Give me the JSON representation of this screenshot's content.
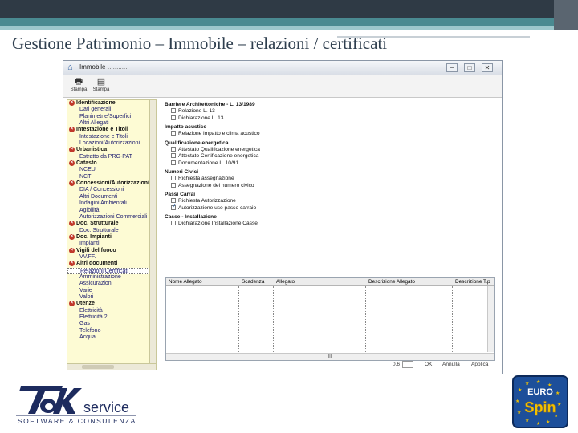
{
  "slide": {
    "title": "Gestione Patrimonio – Immobile – relazioni / certificati"
  },
  "window": {
    "title": "Immobile",
    "subtitle": "...........",
    "buttons": {
      "minimize": "─",
      "maximize": "□",
      "close": "✕"
    }
  },
  "toolbar": {
    "items": [
      {
        "label": "Stampa",
        "icon": "printer-icon"
      },
      {
        "label": "Stampa",
        "icon": "print-preview-icon"
      }
    ]
  },
  "tree": {
    "rows": [
      {
        "label": "Identificazione",
        "type": "section"
      },
      {
        "label": "Dati generali",
        "type": "sub"
      },
      {
        "label": "Planimetrie/Superfici",
        "type": "sub"
      },
      {
        "label": "Altri Allegati",
        "type": "sub"
      },
      {
        "label": "Intestazione e Titoli",
        "type": "section"
      },
      {
        "label": "Intestazione e Titoli",
        "type": "sub"
      },
      {
        "label": "Locazioni/Autorizzazioni",
        "type": "sub"
      },
      {
        "label": "Urbanistica",
        "type": "section"
      },
      {
        "label": "Estratto da PRG-PAT",
        "type": "sub"
      },
      {
        "label": "Catasto",
        "type": "section"
      },
      {
        "label": "NCEU",
        "type": "sub"
      },
      {
        "label": "NCT",
        "type": "sub"
      },
      {
        "label": "Concessioni/Autorizzazioni",
        "type": "section"
      },
      {
        "label": "DIA / Concessioni",
        "type": "sub"
      },
      {
        "label": "Altri Documenti",
        "type": "sub"
      },
      {
        "label": "Indagini Ambientali",
        "type": "sub"
      },
      {
        "label": "Agibilità",
        "type": "sub"
      },
      {
        "label": "Autorizzazioni Commerciali",
        "type": "sub"
      },
      {
        "label": "Doc. Strutturale",
        "type": "section"
      },
      {
        "label": "Doc. Strutturale",
        "type": "sub"
      },
      {
        "label": "Doc. Impianti",
        "type": "section"
      },
      {
        "label": "Impianti",
        "type": "sub"
      },
      {
        "label": "Vigili del fuoco",
        "type": "section"
      },
      {
        "label": "VV.FF.",
        "type": "sub"
      },
      {
        "label": "Altri documenti",
        "type": "section"
      },
      {
        "label": "Relazioni/Certificati",
        "type": "sub",
        "selected": true
      },
      {
        "label": "Amministrazione",
        "type": "sub"
      },
      {
        "label": "Assicurazioni",
        "type": "sub"
      },
      {
        "label": "Varie",
        "type": "sub"
      },
      {
        "label": "Valori",
        "type": "sub"
      },
      {
        "label": "Utenze",
        "type": "section"
      },
      {
        "label": "Elettricità",
        "type": "sub"
      },
      {
        "label": "Elettricità 2",
        "type": "sub"
      },
      {
        "label": "Gas",
        "type": "sub"
      },
      {
        "label": "Telefono",
        "type": "sub"
      },
      {
        "label": "Acqua",
        "type": "sub"
      }
    ]
  },
  "panel": {
    "groups": [
      {
        "heading": "Barriere Architettoniche - L. 13/1989",
        "items": [
          {
            "label": "Relazione L. 13",
            "checked": false
          },
          {
            "label": "Dichiarazione L. 13",
            "checked": false
          }
        ]
      },
      {
        "heading": "Impatto acustico",
        "items": [
          {
            "label": "Relazione impatto e clima acustico",
            "checked": false
          }
        ]
      },
      {
        "heading": "Qualificazione energetica",
        "items": [
          {
            "label": "Attestato Qualificazione energetica",
            "checked": false
          },
          {
            "label": "Attestato Certificazione energetica",
            "checked": false
          },
          {
            "label": "Documentazione L. 10/91",
            "checked": false
          }
        ]
      },
      {
        "heading": "Numeri Civici",
        "items": [
          {
            "label": "Richiesta assegnazione",
            "checked": false
          },
          {
            "label": "Assegnazione del numero civico",
            "checked": false
          }
        ]
      },
      {
        "heading": "Passi Carrai",
        "items": [
          {
            "label": "Richiesta Autorizzazione",
            "checked": false
          },
          {
            "label": "Autorizzazione uso passo carraio",
            "checked": true
          }
        ]
      },
      {
        "heading": "Casse - Installazione",
        "items": [
          {
            "label": "Dichiarazione Installazione Casse",
            "checked": false
          }
        ]
      }
    ]
  },
  "grid": {
    "columns": [
      "Nome Allegato",
      "Scadenza",
      "Allegato",
      "Descrizione Allegato",
      "Descrizione T.p"
    ],
    "scroll_label": "III"
  },
  "footer": {
    "zoom_label": "0.6",
    "ok_label": "OK",
    "cancel_label": "Annulla",
    "apply_label": "Applica"
  },
  "logos": {
    "left_mark": "TeK",
    "left_word": "service",
    "left_tagline": "SOFTWARE & CONSULENZA",
    "right_top": "EURO",
    "right_main": "Spin"
  },
  "colors": {
    "tree_bg": "#fdfbd4",
    "accent": "#c0392b",
    "brand_blue": "#1d4f9a"
  }
}
